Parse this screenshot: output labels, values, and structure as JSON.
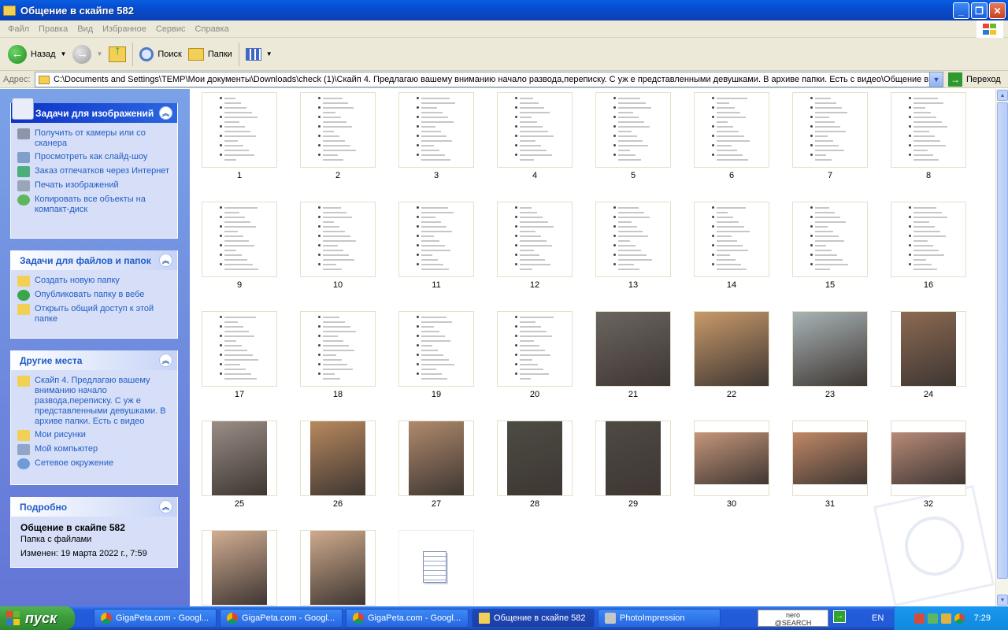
{
  "window": {
    "title": "Общение в скайпе 582",
    "buttons": {
      "minimize": "_",
      "maximize": "❐",
      "close": "✕"
    }
  },
  "menu": [
    "Файл",
    "Правка",
    "Вид",
    "Избранное",
    "Сервис",
    "Справка"
  ],
  "toolbar": {
    "back_label": "Назад",
    "search_label": "Поиск",
    "folders_label": "Папки"
  },
  "address": {
    "label": "Адрес:",
    "path": "C:\\Documents and Settings\\TEMP\\Мои документы\\Downloads\\check (1)\\Скайп 4. Предлагаю вашему вниманию начало развода,переписку. С уж е представленными девушками. В архиве папки. Есть с видео\\Общение в с",
    "go_label": "Переход"
  },
  "sidebar": {
    "image_tasks": {
      "title": "Задачи для изображений",
      "items": [
        "Получить от камеры или со сканера",
        "Просмотреть как слайд-шоу",
        "Заказ отпечатков через Интернет",
        "Печать изображений",
        "Копировать все объекты на компакт-диск"
      ]
    },
    "file_tasks": {
      "title": "Задачи для файлов и папок",
      "items": [
        "Создать новую папку",
        "Опубликовать папку в вебе",
        "Открыть общий доступ к этой папке"
      ]
    },
    "other_places": {
      "title": "Другие места",
      "items": [
        "Скайп 4. Предлагаю вашему вниманию начало развода,переписку. С уж е представленными девушками. В архиве папки. Есть с видео",
        "Мои рисунки",
        "Мой компьютер",
        "Сетевое окружение"
      ]
    },
    "details": {
      "title": "Подробно",
      "name": "Общение в скайпе 582",
      "type": "Папка с файлами",
      "modified": "Изменен: 19 марта 2022 г., 7:59"
    }
  },
  "thumbnails": [
    {
      "caption": "1",
      "kind": "doc"
    },
    {
      "caption": "2",
      "kind": "doc"
    },
    {
      "caption": "3",
      "kind": "doc"
    },
    {
      "caption": "4",
      "kind": "doc"
    },
    {
      "caption": "5",
      "kind": "doc"
    },
    {
      "caption": "6",
      "kind": "doc"
    },
    {
      "caption": "7",
      "kind": "doc"
    },
    {
      "caption": "8",
      "kind": "doc"
    },
    {
      "caption": "9",
      "kind": "doc"
    },
    {
      "caption": "10",
      "kind": "doc"
    },
    {
      "caption": "11",
      "kind": "doc"
    },
    {
      "caption": "12",
      "kind": "doc"
    },
    {
      "caption": "13",
      "kind": "doc"
    },
    {
      "caption": "14",
      "kind": "doc"
    },
    {
      "caption": "15",
      "kind": "doc"
    },
    {
      "caption": "16",
      "kind": "doc"
    },
    {
      "caption": "17",
      "kind": "doc"
    },
    {
      "caption": "18",
      "kind": "doc"
    },
    {
      "caption": "19",
      "kind": "doc"
    },
    {
      "caption": "20",
      "kind": "doc"
    },
    {
      "caption": "21",
      "kind": "photo",
      "tone": "#6b6560"
    },
    {
      "caption": "22",
      "kind": "photo",
      "tone": "#c99a6a"
    },
    {
      "caption": "23",
      "kind": "photo",
      "tone": "#a8b4b6"
    },
    {
      "caption": "24",
      "kind": "photo",
      "tone": "#8c6a52"
    },
    {
      "caption": "25",
      "kind": "photo",
      "tone": "#9a8e86"
    },
    {
      "caption": "26",
      "kind": "photo",
      "tone": "#b8895e"
    },
    {
      "caption": "27",
      "kind": "photo",
      "tone": "#b08a6c"
    },
    {
      "caption": "28",
      "kind": "photo",
      "tone": "#4c4c44"
    },
    {
      "caption": "29",
      "kind": "photo",
      "tone": "#4e4a44"
    },
    {
      "caption": "30",
      "kind": "photo",
      "tone": "#c6967a"
    },
    {
      "caption": "31",
      "kind": "photo",
      "tone": "#c08866"
    },
    {
      "caption": "32",
      "kind": "photo",
      "tone": "#b88a78"
    },
    {
      "caption": "",
      "kind": "photo",
      "tone": "#d2ad92"
    },
    {
      "caption": "",
      "kind": "photo",
      "tone": "#cfaa8c"
    },
    {
      "caption": "",
      "kind": "notepad"
    }
  ],
  "taskbar": {
    "start_label": "пуск",
    "buttons": [
      "GigaPeta.com - Googl...",
      "GigaPeta.com - Googl...",
      "GigaPeta.com - Googl...",
      "Общение в скайпе 582",
      "PhotoImpression"
    ],
    "nero": "nero\n@SEARCH",
    "lang": "EN",
    "clock": "7:29"
  }
}
